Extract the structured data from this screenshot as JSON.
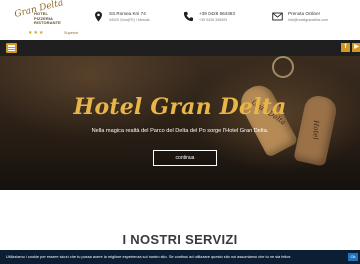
{
  "logo": {
    "wordmark": "Gran Delta",
    "lines": [
      "HOTEL",
      "PIZZERIA",
      "RISTORANTE"
    ],
    "stars": "★★★",
    "tier": "Superior"
  },
  "header": {
    "address": {
      "line1": "SS.Romea Km 74",
      "line2": "44020 Goro(FE) / Mesola",
      "icon": "location-pin-icon"
    },
    "phone": {
      "line1": "+39 0426 664363",
      "line2": "+39 0426 345009",
      "icon": "phone-icon"
    },
    "email": {
      "line1": "Prenota Online!",
      "line2": "info@hotelgrandelta.com",
      "icon": "envelope-icon"
    }
  },
  "nav": {
    "menu_icon": "hamburger-icon",
    "social": [
      {
        "name": "facebook-icon",
        "glyph": "f"
      },
      {
        "name": "youtube-icon",
        "glyph": "▶"
      }
    ]
  },
  "hero": {
    "title": "Hotel Gran Delta",
    "subtitle": "Nella magica realtà del Parco del Delta del Po sorge l'Hotel Gran Delta.",
    "button": "continua",
    "tag_text": "Gran Delta",
    "tag_text2": "Hotel"
  },
  "services": {
    "title": "I NOSTRI SERVIZI"
  },
  "cookie_bar": {
    "text": "Utilizziamo i cookie per essere sicuri che tu possa avere la migliore esperienza sul nostro sito. Se continui ad utilizzare questo sito noi assumiamo che tu ne sia felice.",
    "ok": "Ok"
  },
  "colors": {
    "accent": "#d19a1f",
    "hero_title": "#e8b547",
    "navbar": "#1f1f1f",
    "cookie_bg": "#0b1e33"
  }
}
